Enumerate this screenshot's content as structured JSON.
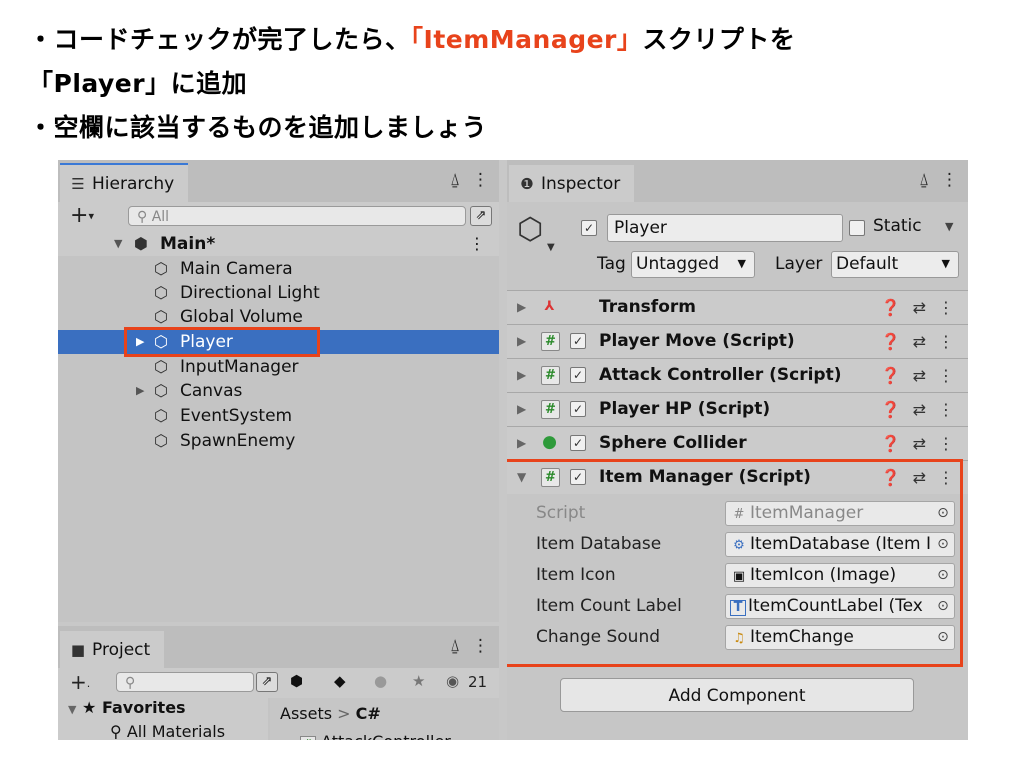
{
  "slide": {
    "line1_prefix": "・コードチェックが完了したら、",
    "line1_highlight": "「ItemManager」",
    "line1_suffix": "スクリプトを",
    "line2": "「Player」に追加",
    "line3": "・空欄に該当するものを追加しましょう",
    "highlight_color": "#e8431b"
  },
  "hierarchy": {
    "tab_label": "Hierarchy",
    "search_placeholder": "All",
    "scene": "Main*",
    "items": [
      {
        "label": "Main Camera"
      },
      {
        "label": "Directional Light"
      },
      {
        "label": "Global Volume"
      },
      {
        "label": "Player",
        "selected": true
      },
      {
        "label": "InputManager"
      },
      {
        "label": "Canvas"
      },
      {
        "label": "EventSystem"
      },
      {
        "label": "SpawnEnemy"
      }
    ]
  },
  "project": {
    "tab_label": "Project",
    "count": "21",
    "favorites_label": "Favorites",
    "all_materials": "All Materials",
    "breadcrumb_root": "Assets",
    "breadcrumb_sep": ">",
    "breadcrumb_folder": "C#",
    "first_file": "AttackController"
  },
  "inspector": {
    "tab_label": "Inspector",
    "object_name": "Player",
    "static_label": "Static",
    "tag_label": "Tag",
    "tag_value": "Untagged",
    "layer_label": "Layer",
    "layer_value": "Default",
    "components": [
      {
        "name": "Transform"
      },
      {
        "name": "Player Move (Script)"
      },
      {
        "name": "Attack Controller (Script)"
      },
      {
        "name": "Player HP (Script)"
      },
      {
        "name": "Sphere Collider"
      },
      {
        "name": "Item Manager (Script)"
      }
    ],
    "properties": [
      {
        "label": "Script",
        "value": "ItemManager"
      },
      {
        "label": "Item Database",
        "value": "ItemDatabase (Item I"
      },
      {
        "label": "Item Icon",
        "value": "ItemIcon (Image)"
      },
      {
        "label": "Item Count Label",
        "value": "ItemCountLabel (Tex"
      },
      {
        "label": "Change Sound",
        "value": "ItemChange"
      }
    ],
    "add_component_label": "Add Component"
  }
}
